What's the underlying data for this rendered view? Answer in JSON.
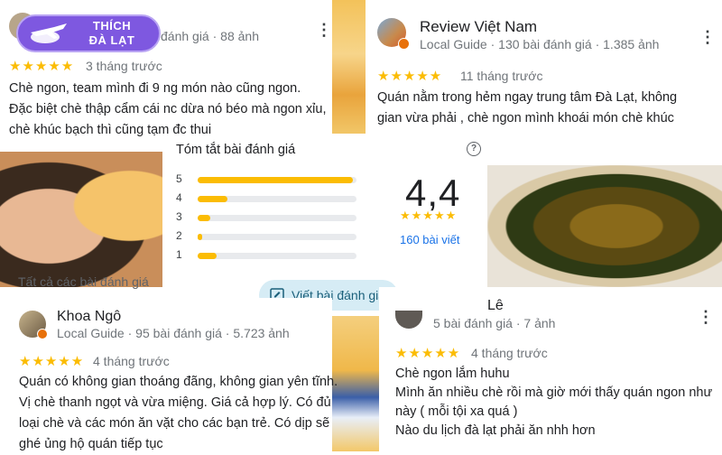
{
  "logo": {
    "line1": "THÍCH",
    "line2": "ĐÀ LẠT"
  },
  "review_top_left": {
    "meta_tail": "đánh giá · 88 ảnh",
    "stars": "★★★★★",
    "date": "3 tháng trước",
    "lines": [
      "Chè ngon, team mình đi 9 ng món nào cũng ngon.",
      "Đặc biệt chè thập cẩm cái nc dừa nó béo mà ngon xỉu,",
      "chè khúc bạch thì cũng tạm đc thui"
    ]
  },
  "review_top_right": {
    "name": "Review Việt Nam",
    "meta": "Local Guide · 130 bài đánh giá · 1.385 ảnh",
    "stars": "★★★★★",
    "date": "11 tháng trước",
    "lines": [
      "Quán nằm trong hẻm ngay trung tâm Đà Lạt, không",
      "gian vừa phải , chè ngon mình khoái món chè khúc"
    ]
  },
  "summary": {
    "title": "Tóm tắt bài đánh giá",
    "rating": "4,4",
    "stars": "★★★★★",
    "count": "160 bài viết",
    "help": "?",
    "write_label": "Viết bài đánh giá",
    "bars": [
      {
        "label": "5",
        "fraction": 0.98
      },
      {
        "label": "4",
        "fraction": 0.19
      },
      {
        "label": "3",
        "fraction": 0.08
      },
      {
        "label": "2",
        "fraction": 0.03
      },
      {
        "label": "1",
        "fraction": 0.12
      }
    ],
    "obscured_text": "Tất cả các bài đánh giá"
  },
  "review_bottom_left": {
    "name": "Khoa Ngô",
    "meta": "Local Guide · 95 bài đánh giá · 5.723 ảnh",
    "stars": "★★★★★",
    "date": "4 tháng trước",
    "lines": [
      "Quán có không gian thoáng đãng, không gian yên tĩnh.",
      "Vị chè thanh ngọt và vừa miệng. Giá cả hợp lý. Có đủ",
      "loại chè và các món ăn vặt cho các bạn trẻ. Có dịp sẽ",
      "ghé ủng hộ quán tiếp tục"
    ]
  },
  "review_bottom_right": {
    "name": "Lê",
    "meta": "5 bài đánh giá · 7 ảnh",
    "stars": "★★★★★",
    "date": "4 tháng trước",
    "lines": [
      "Chè ngon lắm huhu",
      "Mình ăn nhiều chè rồi mà giờ mới thấy quán ngon như",
      "này ( mỗi tội xa quá )",
      "Nào du lịch đà lạt phải ăn nhh hơn"
    ]
  },
  "colors": {
    "star": "#fbbc04",
    "logo_bg": "#7e58e0",
    "write_btn_bg": "#d6ecf5",
    "count_link": "#1a73e8"
  }
}
